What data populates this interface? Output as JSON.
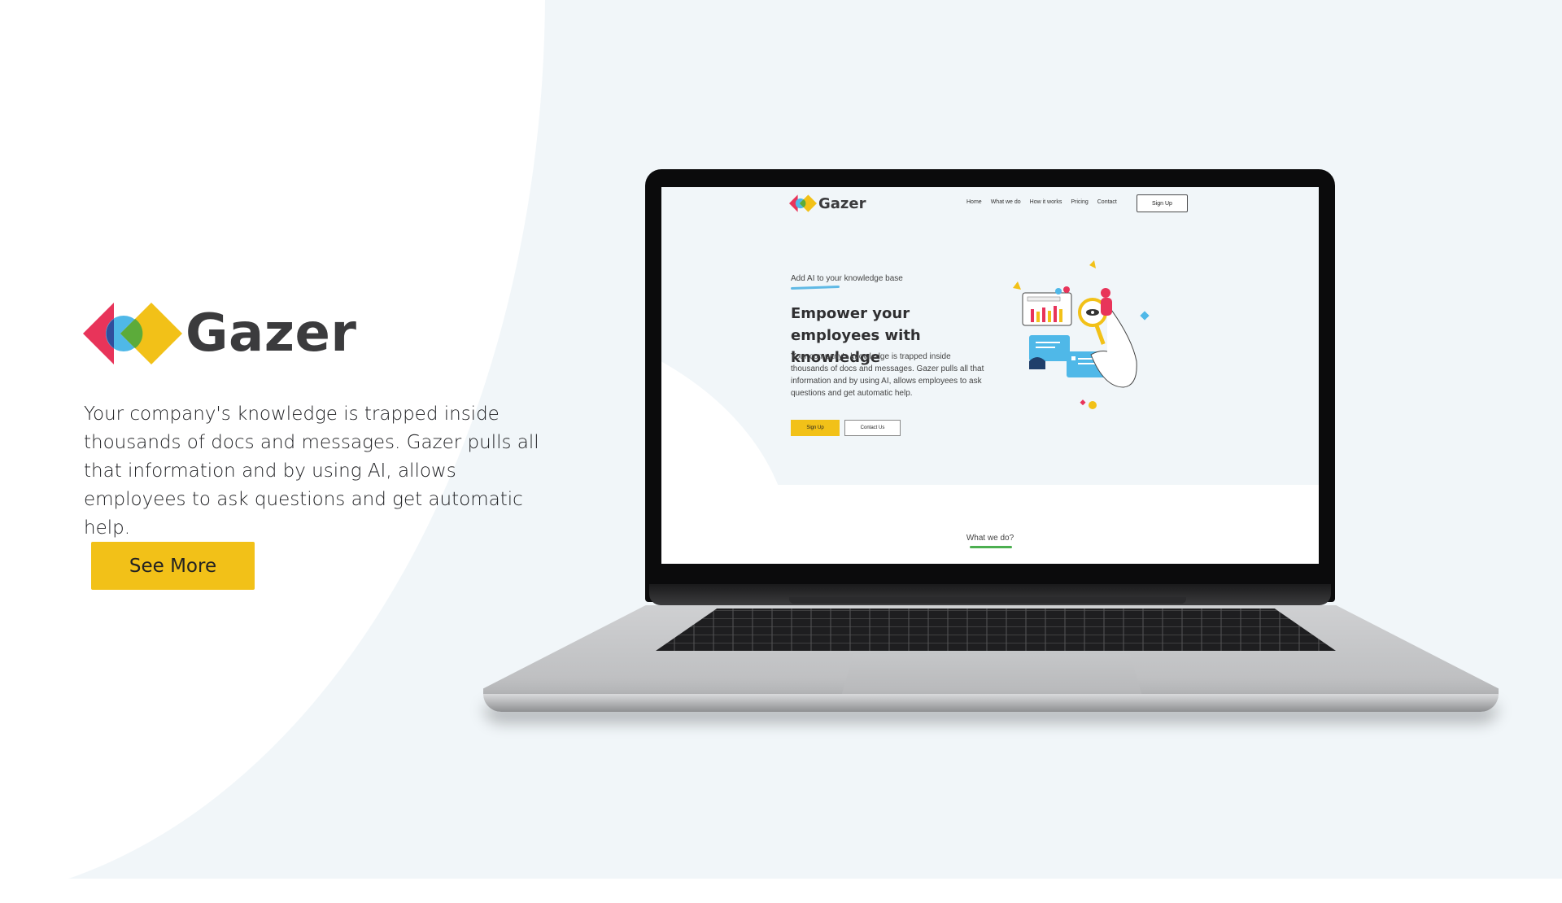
{
  "promo": {
    "brand": "Gazer",
    "description": "Your company's knowledge is trapped inside thousands of docs and messages. Gazer pulls all that information and by using AI, allows employees to ask questions and get automatic help.",
    "cta_label": "See More"
  },
  "site": {
    "brand": "Gazer",
    "nav": [
      "Home",
      "What we do",
      "How it works",
      "Pricing",
      "Contact"
    ],
    "signup_label": "Sign Up",
    "kicker": "Add AI to your knowledge base",
    "headline": "Empower your employees with knowledge",
    "description": "Your company's knowledge is trapped inside thousands of docs and messages. Gazer pulls all that information and by using AI, allows employees to ask questions and get automatic help.",
    "hero_signup_label": "Sign Up",
    "hero_contact_label": "Contact Us",
    "section_title": "What we do?"
  },
  "colors": {
    "accent": "#f2c118",
    "logo_red": "#e8345a",
    "logo_blue": "#4fb8e8",
    "logo_green": "#5cab3a",
    "background": "#f1f6f9"
  }
}
